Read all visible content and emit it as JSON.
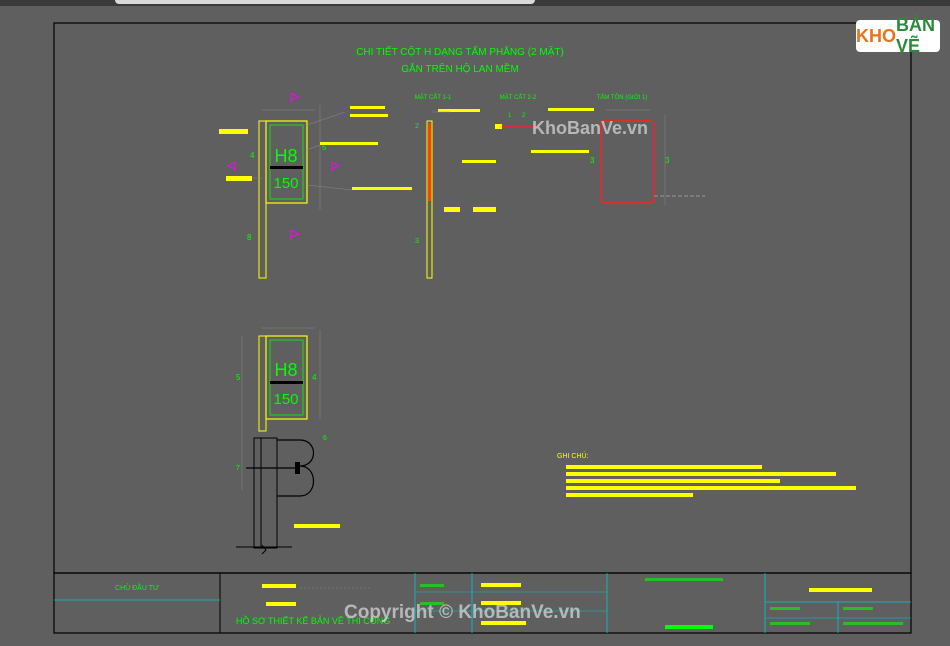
{
  "sheet": {
    "title_line1": "CHI TIẾT CỘT H DẠNG TẤM PHẲNG (2 MẶT)",
    "title_line2": "GẮN TRÊN HỘ LAN MỀM",
    "section_labels": [
      "MẶT CẮT 1-1",
      "MẶT CẮT 2-2",
      "TẤM TÔN (GIỚI 1)"
    ],
    "sign_code": "H8",
    "sign_value": "150",
    "notes_heading": "GHI CHÚ:"
  },
  "title_block": {
    "left_cell": "CHỦ ĐẦU TƯ",
    "drawing_title": "HỒ SƠ THIẾT KẾ BẢN VẼ THI CÔNG"
  },
  "logo": {
    "part1": "KHO",
    "part2": "BẢN VẼ"
  },
  "watermarks": {
    "center": "KhoBanVe.vn",
    "bottom": "Copyright © KhoBanVe.vn"
  },
  "colors": {
    "background": "#5f5f5f",
    "frame": "#000000",
    "yellow": "#ffff00",
    "green": "#00ff00",
    "red": "#ff2020",
    "magenta": "#ff00ff",
    "cyan": "#00c8d0"
  }
}
